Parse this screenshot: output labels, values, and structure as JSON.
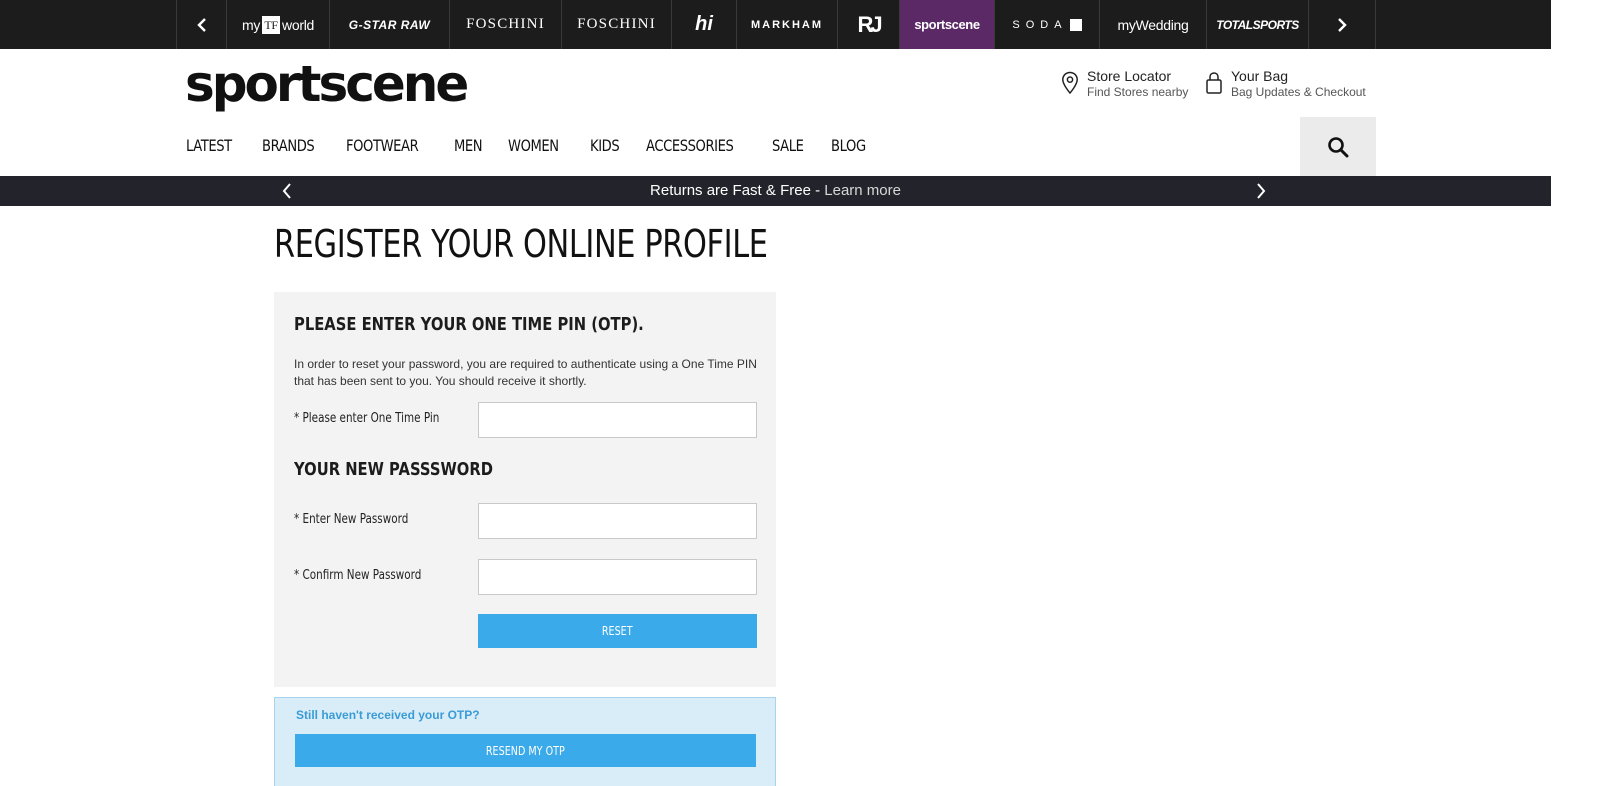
{
  "brand_bar": {
    "brands": [
      {
        "pre": "my",
        "mark": "TF",
        "post": "world"
      },
      {
        "label": "G-STAR RAW"
      },
      {
        "label": "FOSCHINI"
      },
      {
        "label": "FOSCHINI"
      },
      {
        "label": "hi"
      },
      {
        "label": "MARKHAM"
      },
      {
        "label": "RJ"
      },
      {
        "label": "sportscene",
        "active": true
      },
      {
        "label": "SODA"
      },
      {
        "label": "myWedding"
      },
      {
        "label": "TOTALSPORTS"
      }
    ],
    "colors": {
      "background": "#1c1c1c",
      "active": "#5b2a66"
    }
  },
  "header": {
    "logo": "sportscene",
    "store_locator": {
      "title": "Store Locator",
      "subtitle": "Find Stores nearby",
      "icon": "map-pin-icon"
    },
    "bag": {
      "title": "Your Bag",
      "subtitle": "Bag Updates & Checkout",
      "icon": "shopping-bag-icon"
    },
    "search_icon": "search-icon"
  },
  "nav": {
    "items": [
      "LATEST",
      "BRANDS",
      "FOOTWEAR",
      "MEN",
      "WOMEN",
      "KIDS",
      "ACCESSORIES",
      "SALE",
      "BLOG"
    ]
  },
  "promo": {
    "message": "Returns are Fast & Free",
    "separator": " - ",
    "link": "Learn more"
  },
  "page": {
    "title": "REGISTER YOUR ONLINE PROFILE",
    "otp_heading": "PLEASE ENTER YOUR ONE TIME PIN (OTP).",
    "otp_description": "In order to reset your password, you are required to authenticate using a One Time PIN that has been sent to you. You should receive it shortly.",
    "otp_label": "* Please enter One Time Pin",
    "otp_value": "",
    "password_heading": "YOUR NEW PASSSWORD",
    "new_password_label": "* Enter New Password",
    "new_password_value": "",
    "confirm_password_label": "* Confirm New Password",
    "confirm_password_value": "",
    "reset_button": "RESET",
    "resend_question": "Still haven't received your OTP?",
    "resend_button": "RESEND MY OTP"
  },
  "colors": {
    "button": "#3baaeb",
    "panel": "#f3f3f3",
    "otp_box": "#d9edf8",
    "promo_bar": "#23232b"
  }
}
